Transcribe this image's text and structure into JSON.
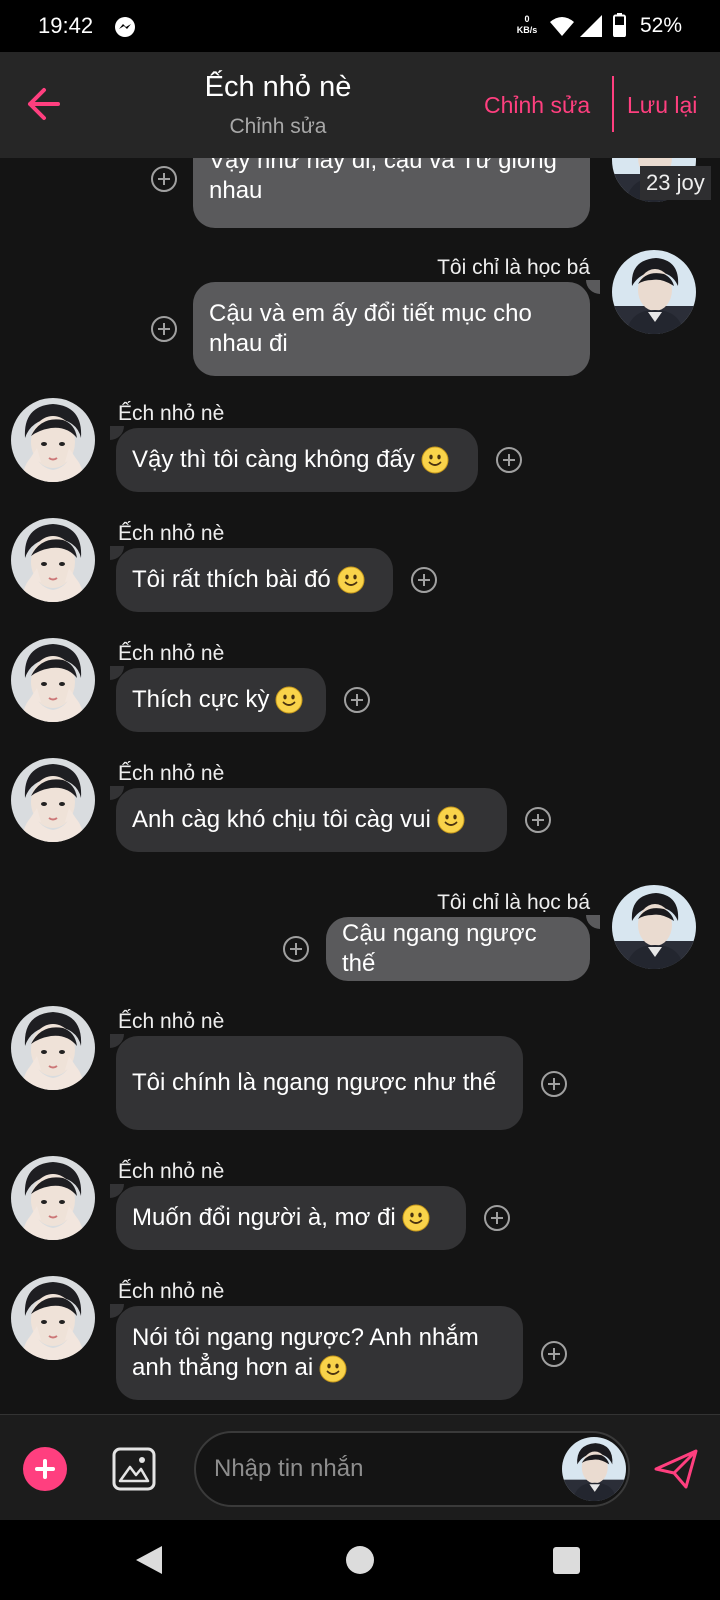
{
  "status_bar": {
    "time": "19:42",
    "net_speed_value": "0",
    "net_speed_unit": "KB/s",
    "battery": "52%"
  },
  "header": {
    "title": "Ếch nhỏ nè",
    "subtitle": "Chỉnh sửa",
    "edit_label": "Chỉnh sửa",
    "save_label": "Lưu lại"
  },
  "top_badge": "23 joy",
  "messages": [
    {
      "sender": "",
      "text": "Vậy như này đi, cậu và Tư giống nhau",
      "direction": "out"
    },
    {
      "sender": "Tôi chỉ là học bá",
      "text": "Cậu và em ấy đổi tiết mục cho nhau đi",
      "direction": "out"
    },
    {
      "sender": "Ếch nhỏ nè",
      "text": "Vậy thì tôi càng không đấy",
      "direction": "in",
      "emoji": "slightly-smiling-emoji"
    },
    {
      "sender": "Ếch nhỏ nè",
      "text": "Tôi rất thích bài đó",
      "direction": "in",
      "emoji": "slightly-smiling-emoji"
    },
    {
      "sender": "Ếch nhỏ nè",
      "text": "Thích cực kỳ",
      "direction": "in",
      "emoji": "slightly-smiling-emoji"
    },
    {
      "sender": "Ếch nhỏ nè",
      "text": "Anh càg khó chịu tôi càg vui",
      "direction": "in",
      "emoji": "slightly-smiling-emoji"
    },
    {
      "sender": "Tôi chỉ là học bá",
      "text": "Cậu ngang ngược thế",
      "direction": "out"
    },
    {
      "sender": "Ếch nhỏ nè",
      "text": "Tôi chính là ngang ngược như thế",
      "direction": "in"
    },
    {
      "sender": "Ếch nhỏ nè",
      "text": "Muốn đổi người à, mơ đi",
      "direction": "in",
      "emoji": "slightly-smiling-emoji"
    },
    {
      "sender": "Ếch nhỏ nè",
      "text": "Nói tôi ngang ngược? Anh nhắm anh thẳng hơn ai",
      "direction": "in",
      "emoji": "slightly-smiling-emoji"
    }
  ],
  "composer": {
    "placeholder": "Nhập tin nhắn"
  },
  "colors": {
    "accent": "#ff3f7f",
    "bubble_in": "#333335",
    "bubble_out": "#5a5a5c",
    "background": "#141414"
  },
  "icons": [
    "back-arrow-icon",
    "messenger-icon",
    "wifi-icon",
    "signal-icon",
    "battery-icon",
    "add-reaction-icon",
    "slightly-smiling-emoji",
    "add-icon",
    "image-icon",
    "send-icon",
    "nav-back-icon",
    "nav-home-icon",
    "nav-recent-icon"
  ]
}
